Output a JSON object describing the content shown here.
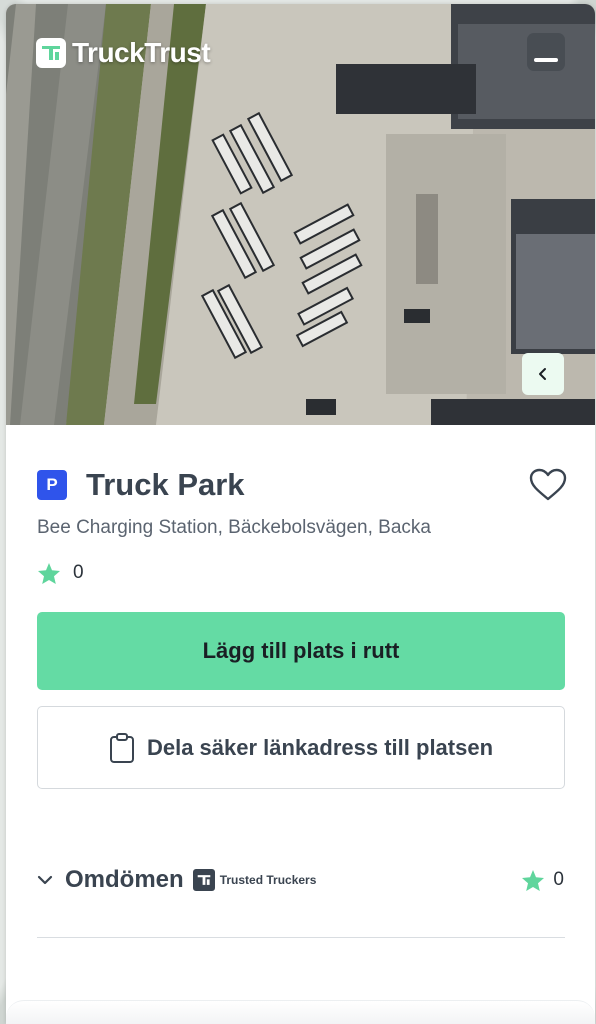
{
  "app": {
    "brand_name": "TruckTrust"
  },
  "place": {
    "type_badge": "P",
    "name": "Truck Park",
    "address": "Bee Charging Station, Bäckebolsvägen, Backa",
    "rating": "0"
  },
  "actions": {
    "add_to_route_label": "Lägg till plats i rutt",
    "share_link_label": "Dela säker länkadress till platsen"
  },
  "reviews": {
    "title": "Omdömen",
    "source_label": "Trusted Truckers",
    "rating": "0"
  },
  "icons": {
    "brand": "trucktrust-logo-icon",
    "menu": "minimize-icon",
    "collapse": "chevron-left-icon",
    "favorite": "heart-outline-icon",
    "rating": "star-icon",
    "share": "clipboard-icon",
    "expand": "chevron-down-icon"
  },
  "colors": {
    "accent": "#64dba4",
    "parking_badge": "#2f54eb",
    "text_primary": "#3a4450",
    "star": "#5fd59c"
  }
}
